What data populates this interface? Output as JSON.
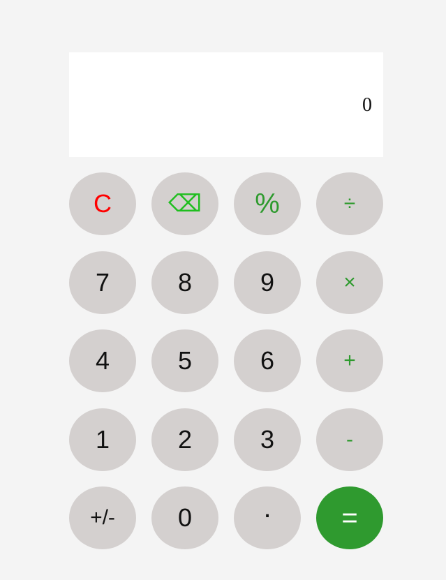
{
  "display": {
    "value": "0"
  },
  "keys": {
    "clear": "C",
    "backspace": "⌫",
    "percent": "%",
    "divide": "÷",
    "seven": "7",
    "eight": "8",
    "nine": "9",
    "multiply": "×",
    "four": "4",
    "five": "5",
    "six": "6",
    "add": "+",
    "one": "1",
    "two": "2",
    "three": "3",
    "subtract": "-",
    "sign": "+/-",
    "zero": "0",
    "decimal": ".",
    "equals": "="
  },
  "colors": {
    "background": "#f4f4f4",
    "display_background": "#ffffff",
    "key_background": "#d4d0cf",
    "clear": "#ff0000",
    "backspace": "#1fbe1f",
    "operator": "#2e9a2e",
    "equals_background": "#2f9a2f",
    "equals_text": "#ffffff"
  }
}
